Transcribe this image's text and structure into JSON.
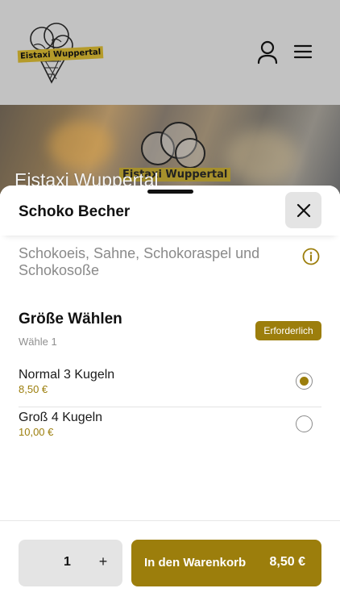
{
  "header": {
    "logo_text": "Eistaxi Wuppertal",
    "user_icon": "user-icon",
    "menu_icon": "hamburger-menu-icon"
  },
  "hero": {
    "logo_text": "Eistaxi Wuppertal",
    "title": "Eistaxi Wuppertal"
  },
  "product": {
    "title": "Schoko Becher",
    "description": "Schokoeis, Sahne, Schokoraspel und Schokosoße"
  },
  "options_group": {
    "title": "Größe Wählen",
    "subtitle": "Wähle 1",
    "badge": "Erforderlich",
    "options": [
      {
        "name": "Normal 3 Kugeln",
        "price": "8,50 €",
        "selected": true
      },
      {
        "name": "Groß 4 Kugeln",
        "price": "10,00 €",
        "selected": false
      }
    ]
  },
  "footer": {
    "quantity": "1",
    "plus_label": "+",
    "cart_label": "In den Warenkorb",
    "cart_price": "8,50 €"
  },
  "colors": {
    "accent": "#9c7e0c",
    "overlay": "#c2c2c2"
  }
}
